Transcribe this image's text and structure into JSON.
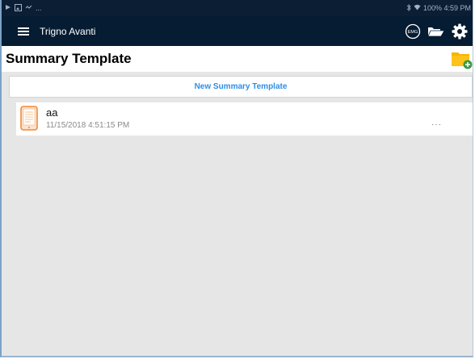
{
  "status_bar": {
    "left_overflow": "...",
    "right_text": "100% 4:59 PM"
  },
  "app_bar": {
    "title": "Trigno Avanti",
    "actions": [
      {
        "icon": "emg-sensor-icon",
        "label": "EMG"
      },
      {
        "icon": "folder-open-icon"
      },
      {
        "icon": "gear-icon"
      }
    ]
  },
  "header": {
    "title": "Summary Template",
    "add_icon": "folder-add-icon"
  },
  "new_template": {
    "label": "New Summary Template"
  },
  "templates": [
    {
      "name": "aa",
      "date": "11/15/2018 4:51:15 PM",
      "more": "···"
    }
  ],
  "colors": {
    "app_bar_bg": "#051c33",
    "accent_blue": "#2d8ee6",
    "folder_yellow": "#f7b500",
    "add_green": "#3a9b43",
    "doc_orange": "#f08a3a"
  }
}
